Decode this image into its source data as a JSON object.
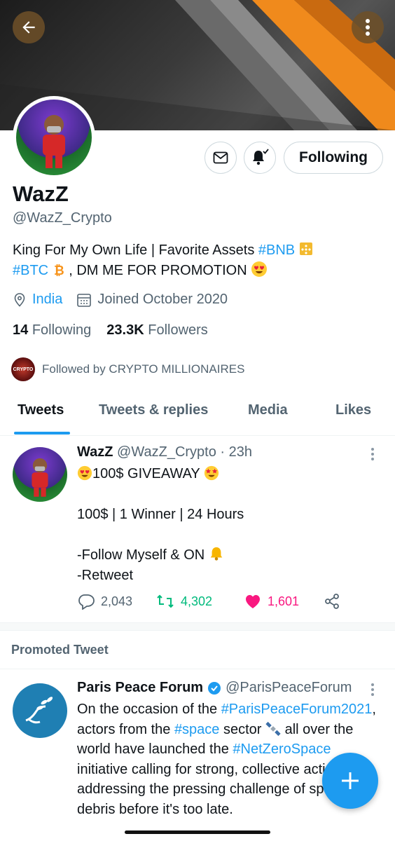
{
  "profile": {
    "name": "WazZ",
    "handle": "@WazZ_Crypto",
    "bio_line1_text": "King For My Own Life | Favorite Assets ",
    "bio_bnb": "#BNB",
    "bio_btc": "#BTC",
    "bio_line2_text": " , DM ME FOR PROMOTION",
    "location": "India",
    "joined": "Joined October 2020",
    "following_count": "14",
    "following_label": "Following",
    "followers_count": "23.3K",
    "followers_label": "Followers",
    "followed_by": "Followed by CRYPTO MILLIONAIRES",
    "mini_avatar_text": "CRYPTO"
  },
  "actions": {
    "follow_label": "Following"
  },
  "tabs": [
    {
      "label": "Tweets"
    },
    {
      "label": "Tweets & replies"
    },
    {
      "label": "Media"
    },
    {
      "label": "Likes"
    }
  ],
  "tweet": {
    "name": "WazZ",
    "handle_time": "@WazZ_Crypto · 23h",
    "line1": "100$ GIVEAWAY",
    "line2": "100$ | 1 Winner | 24 Hours",
    "line3": "-Follow Myself & ON",
    "line4": "-Retweet",
    "replies": "2,043",
    "retweets": "4,302",
    "likes": "1,601"
  },
  "promoted": {
    "label": "Promoted Tweet",
    "name": "Paris Peace Forum",
    "handle": "@ParisPeaceForum",
    "text_1": "On the occasion of the ",
    "tag_1": "#ParisPeaceForum2021",
    "text_2": ", actors from the ",
    "tag_2": "#space",
    "text_3": " sector ",
    "text_4": " all over the world have launched the ",
    "tag_3": "#NetZeroSpace",
    "text_5": " initiative calling for strong, collective action in addressing the pressing challenge of space debris before it's too late."
  },
  "colors": {
    "accent": "#1d9bf0",
    "retweet": "#00ba7c",
    "like": "#f91880",
    "banner_orange": "#f08a1c"
  }
}
